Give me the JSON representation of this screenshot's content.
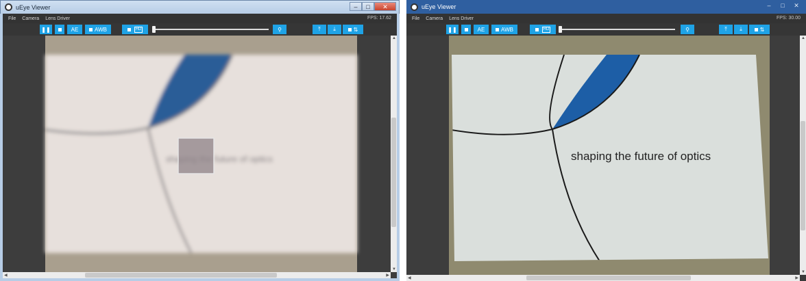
{
  "windows": [
    {
      "title": "uEye Viewer",
      "menu": [
        "File",
        "Camera",
        "Lens Driver"
      ],
      "fps": "FPS: 17.62",
      "toolbar": {
        "ae": "AE",
        "awb": "AWB",
        "hd": "HD"
      },
      "image_text": "shaping the future of optics",
      "focus": "blurred"
    },
    {
      "title": "uEye Viewer",
      "menu": [
        "File",
        "Camera",
        "Lens Driver"
      ],
      "fps": "FPS: 30.00",
      "toolbar": {
        "ae": "AE",
        "awb": "AWB",
        "hd": "HD"
      },
      "image_text": "shaping the future of optics",
      "focus": "sharp"
    }
  ],
  "icons": {
    "pause": "pause-icon",
    "zoom": "zoom-icon",
    "upload": "upload-icon",
    "download": "download-icon",
    "arrows": "up-down-arrows-icon"
  },
  "colors": {
    "toolbar_button": "#1fa3e6",
    "card_blue": "#1d5ea6"
  }
}
